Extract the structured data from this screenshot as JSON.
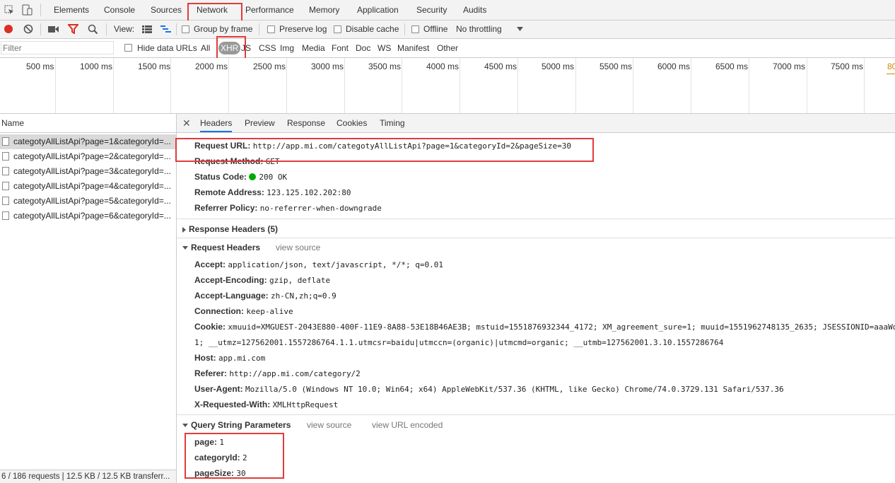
{
  "main_tabs": [
    "Elements",
    "Console",
    "Sources",
    "Network",
    "Performance",
    "Memory",
    "Application",
    "Security",
    "Audits"
  ],
  "toolbar": {
    "view_label": "View:",
    "group_by_frame": "Group by frame",
    "preserve_log": "Preserve log",
    "disable_cache": "Disable cache",
    "offline": "Offline",
    "throttling": "No throttling"
  },
  "filter": {
    "placeholder": "Filter",
    "hide_data_urls": "Hide data URLs",
    "types": [
      "All",
      "XHR",
      "JS",
      "CSS",
      "Img",
      "Media",
      "Font",
      "Doc",
      "WS",
      "Manifest",
      "Other"
    ]
  },
  "timeline": {
    "ticks": [
      "500 ms",
      "1000 ms",
      "1500 ms",
      "2000 ms",
      "2500 ms",
      "3000 ms",
      "3500 ms",
      "4000 ms",
      "4500 ms",
      "5000 ms",
      "5500 ms",
      "6000 ms",
      "6500 ms",
      "7000 ms",
      "7500 ms",
      "80"
    ]
  },
  "requests": {
    "header": "Name",
    "items": [
      "categotyAllListApi?page=1&categoryId=...",
      "categotyAllListApi?page=2&categoryId=...",
      "categotyAllListApi?page=3&categoryId=...",
      "categotyAllListApi?page=4&categoryId=...",
      "categotyAllListApi?page=5&categoryId=...",
      "categotyAllListApi?page=6&categoryId=..."
    ],
    "status": "6 / 186 requests  |  12.5 KB / 12.5 KB transferr..."
  },
  "detail_tabs": [
    "Headers",
    "Preview",
    "Response",
    "Cookies",
    "Timing"
  ],
  "general": [
    {
      "k": "Request URL:",
      "v": "http://app.mi.com/categotyAllListApi?page=1&categoryId=2&pageSize=30"
    },
    {
      "k": "Request Method:",
      "v": "GET"
    },
    {
      "k": "Status Code:",
      "v": "200 OK"
    },
    {
      "k": "Remote Address:",
      "v": "123.125.102.202:80"
    },
    {
      "k": "Referrer Policy:",
      "v": "no-referrer-when-downgrade"
    }
  ],
  "response_headers": "Response Headers (5)",
  "request_headers": {
    "title": "Request Headers",
    "view_source": "view source",
    "items": [
      {
        "k": "Accept:",
        "v": "application/json, text/javascript, */*; q=0.01"
      },
      {
        "k": "Accept-Encoding:",
        "v": "gzip, deflate"
      },
      {
        "k": "Accept-Language:",
        "v": "zh-CN,zh;q=0.9"
      },
      {
        "k": "Connection:",
        "v": "keep-alive"
      },
      {
        "k": "Cookie:",
        "v": "xmuuid=XMGUEST-2043E880-400F-11E9-8A88-53E18B46AE3B; mstuid=1551876932344_4172; XM_agreement_sure=1; muuid=1551962748135_2635; JSESSIONID=aaaWd"
      },
      {
        "k": "",
        "v": "1; __utmz=127562001.1557286764.1.1.utmcsr=baidu|utmccn=(organic)|utmcmd=organic; __utmb=127562001.3.10.1557286764"
      },
      {
        "k": "Host:",
        "v": "app.mi.com"
      },
      {
        "k": "Referer:",
        "v": "http://app.mi.com/category/2"
      },
      {
        "k": "User-Agent:",
        "v": "Mozilla/5.0 (Windows NT 10.0; Win64; x64) AppleWebKit/537.36 (KHTML, like Gecko) Chrome/74.0.3729.131 Safari/537.36"
      },
      {
        "k": "X-Requested-With:",
        "v": "XMLHttpRequest"
      }
    ]
  },
  "query": {
    "title": "Query String Parameters",
    "view_source": "view source",
    "view_url_encoded": "view URL encoded",
    "items": [
      {
        "k": "page:",
        "v": "1"
      },
      {
        "k": "categoryId:",
        "v": "2"
      },
      {
        "k": "pageSize:",
        "v": "30"
      }
    ]
  },
  "colors": {
    "highlight": "#e03b3b",
    "record": "#d93025",
    "accent": "#1a73e8",
    "status_ok": "#00aa00"
  }
}
